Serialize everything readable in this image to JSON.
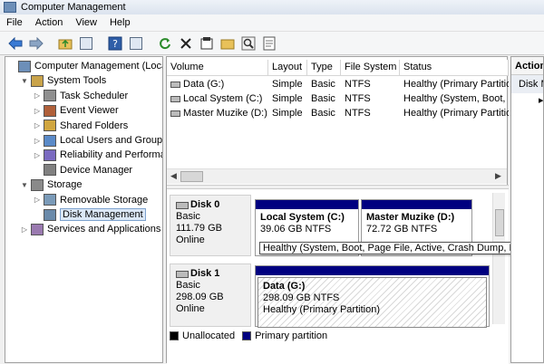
{
  "window": {
    "title": "Computer Management"
  },
  "menu": [
    "File",
    "Action",
    "View",
    "Help"
  ],
  "toolbar_icons": [
    "back-arrow-icon",
    "forward-arrow-icon",
    "up-folder-icon",
    "console-tree-icon",
    "help-icon",
    "properties-icon",
    "refresh-icon",
    "delete-icon",
    "properties-sheet-icon",
    "open-icon",
    "search-icon",
    "export-icon"
  ],
  "tree": [
    {
      "label": "Computer Management (Local",
      "level": 0,
      "expander": "",
      "icon": "computer-icon"
    },
    {
      "label": "System Tools",
      "level": 1,
      "expander": "▼",
      "icon": "tools-icon"
    },
    {
      "label": "Task Scheduler",
      "level": 2,
      "expander": "▷",
      "icon": "task-scheduler-icon"
    },
    {
      "label": "Event Viewer",
      "level": 2,
      "expander": "▷",
      "icon": "event-viewer-icon"
    },
    {
      "label": "Shared Folders",
      "level": 2,
      "expander": "▷",
      "icon": "shared-folders-icon"
    },
    {
      "label": "Local Users and Groups",
      "level": 2,
      "expander": "▷",
      "icon": "users-icon"
    },
    {
      "label": "Reliability and Performa",
      "level": 2,
      "expander": "▷",
      "icon": "performance-icon"
    },
    {
      "label": "Device Manager",
      "level": 2,
      "expander": "",
      "icon": "device-manager-icon"
    },
    {
      "label": "Storage",
      "level": 1,
      "expander": "▼",
      "icon": "storage-icon"
    },
    {
      "label": "Removable Storage",
      "level": 2,
      "expander": "▷",
      "icon": "removable-storage-icon"
    },
    {
      "label": "Disk Management",
      "level": 2,
      "expander": "",
      "icon": "disk-management-icon",
      "selected": true
    },
    {
      "label": "Services and Applications",
      "level": 1,
      "expander": "▷",
      "icon": "services-icon"
    }
  ],
  "volume_table": {
    "columns": [
      "Volume",
      "Layout",
      "Type",
      "File System",
      "Status"
    ],
    "rows": [
      [
        "Data (G:)",
        "Simple",
        "Basic",
        "NTFS",
        "Healthy (Primary Partitio"
      ],
      [
        "Local System (C:)",
        "Simple",
        "Basic",
        "NTFS",
        "Healthy (System, Boot, I"
      ],
      [
        "Master Muzike (D:)",
        "Simple",
        "Basic",
        "NTFS",
        "Healthy (Primary Partitio"
      ]
    ]
  },
  "disks": [
    {
      "name": "Disk 0",
      "type": "Basic",
      "size": "111.79 GB",
      "state": "Online",
      "partitions": [
        {
          "name": "Local System  (C:)",
          "size": "39.06 GB NTFS"
        },
        {
          "name": "Master Muzike  (D:)",
          "size": "72.72 GB NTFS"
        }
      ]
    },
    {
      "name": "Disk 1",
      "type": "Basic",
      "size": "298.09 GB",
      "state": "Online",
      "partitions": [
        {
          "name": "Data  (G:)",
          "size": "298.09 GB NTFS",
          "status": "Healthy (Primary Partition)"
        }
      ]
    }
  ],
  "tooltip": "Healthy (System, Boot, Page File, Active, Crash Dump, Primary Pa",
  "legend": [
    {
      "label": "Unallocated",
      "color": "#000000"
    },
    {
      "label": "Primary partition",
      "color": "#000080"
    }
  ],
  "actions": {
    "header": "Actions",
    "sub": "Disk M"
  }
}
